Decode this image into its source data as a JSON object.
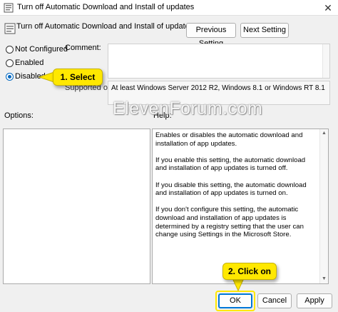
{
  "window": {
    "title": "Turn off Automatic Download and Install of updates",
    "close_glyph": "✕"
  },
  "header": {
    "policy_title": "Turn off Automatic Download and Install of updates",
    "prev_label": "Previous Setting",
    "next_label": "Next Setting"
  },
  "state": {
    "options": [
      {
        "label": "Not Configured",
        "selected": false
      },
      {
        "label": "Enabled",
        "selected": false
      },
      {
        "label": "Disabled",
        "selected": true
      }
    ]
  },
  "comment": {
    "label": "Comment:",
    "value": ""
  },
  "supported": {
    "label": "Supported on:",
    "value": "At least Windows Server 2012 R2, Windows 8.1 or Windows RT 8.1"
  },
  "panes": {
    "options_label": "Options:",
    "help_label": "Help:",
    "help_paragraphs": [
      "Enables or disables the automatic download and installation of app updates.",
      "If you enable this setting, the automatic download and installation of app updates is turned off.",
      "If you disable this setting, the automatic download and installation of app updates is turned on.",
      "If you don't configure this setting, the automatic download and installation of app updates is determined by a registry setting that the user can change using Settings in the Microsoft Store."
    ]
  },
  "footer": {
    "ok_label": "OK",
    "cancel_label": "Cancel",
    "apply_label": "Apply"
  },
  "annotations": {
    "callout_1": "1. Select",
    "callout_2": "2. Click on"
  },
  "watermark": "ElevenForum.com",
  "colors": {
    "accent": "#0067c0",
    "callout": "#ffe800",
    "default_button_border": "#0078d7"
  },
  "icons": {
    "app": "policy-icon",
    "header": "policy-setting-icon",
    "close": "close-icon"
  }
}
